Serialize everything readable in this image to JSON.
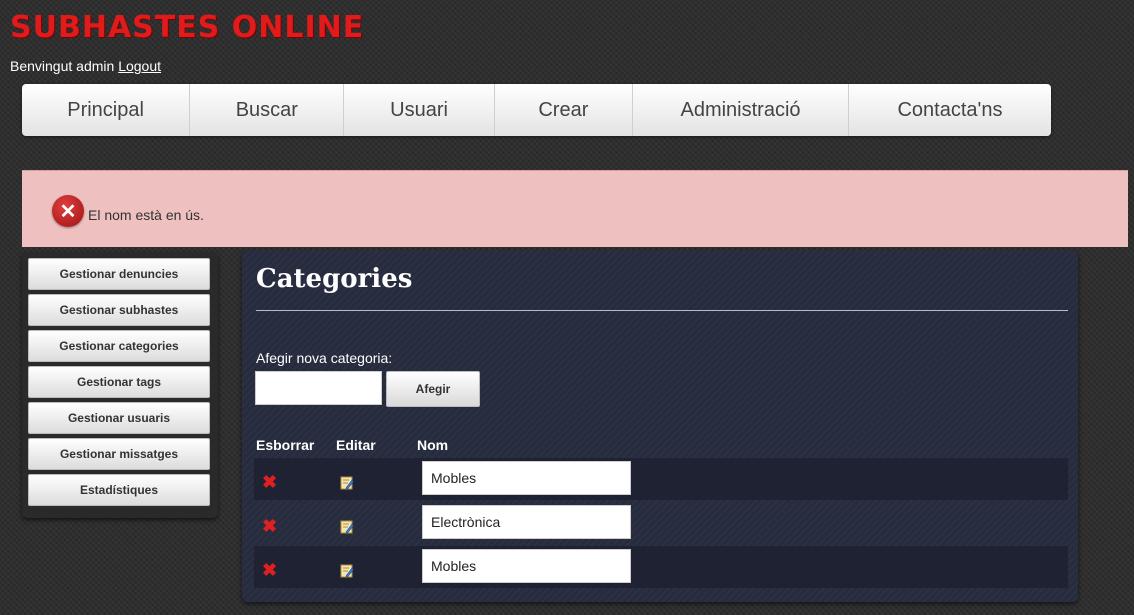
{
  "header": {
    "site_title": "SUBHASTES ONLINE",
    "welcome_text": "Benvingut admin",
    "logout_link": "Logout"
  },
  "nav": {
    "items": [
      "Principal",
      "Buscar",
      "Usuari",
      "Crear",
      "Administració",
      "Contacta'ns"
    ]
  },
  "error": {
    "icon": "error-circle-x-icon",
    "message": "El nom està en ús."
  },
  "sidebar": {
    "items": [
      "Gestionar denuncies",
      "Gestionar subhastes",
      "Gestionar categories",
      "Gestionar tags",
      "Gestionar usuaris",
      "Gestionar missatges",
      "Estadístiques"
    ]
  },
  "main": {
    "title": "Categories",
    "add_label": "Afegir nova categoria:",
    "add_input_value": "",
    "add_button": "Afegir",
    "table": {
      "headers": [
        "Esborrar",
        "Editar",
        "Nom"
      ],
      "rows": [
        {
          "name": "Mobles"
        },
        {
          "name": "Electrònica"
        },
        {
          "name": "Mobles"
        }
      ]
    }
  },
  "colors": {
    "title_red": "#e01b1b",
    "error_bg": "#eec0c0",
    "panel_bg": "#262b3e",
    "delete_red": "#e02020"
  }
}
